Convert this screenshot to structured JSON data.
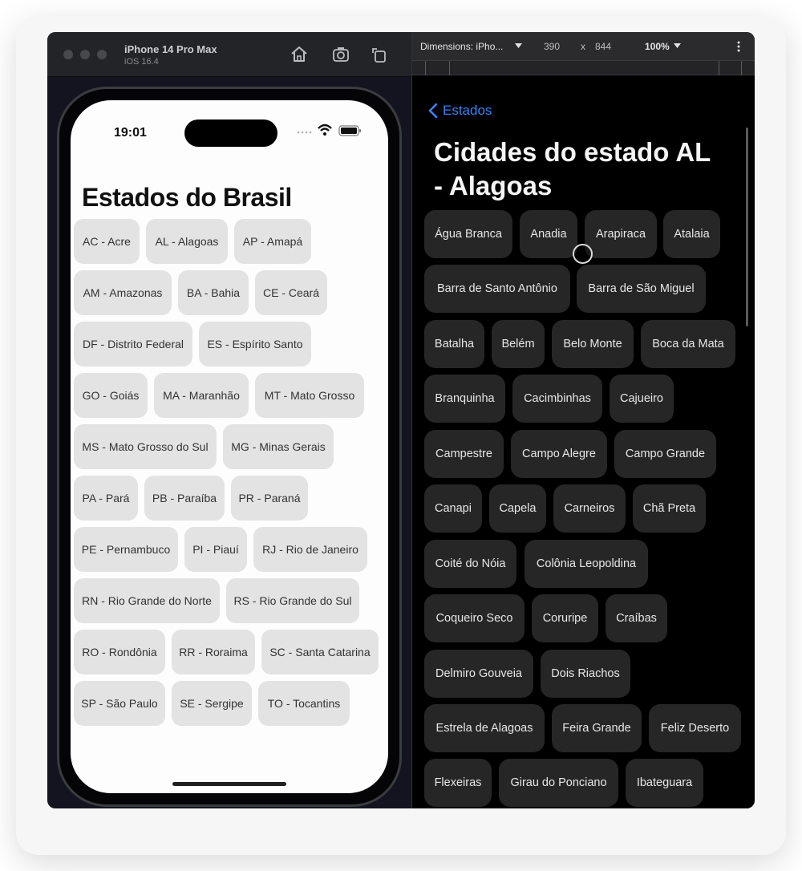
{
  "simulator": {
    "device_name": "iPhone 14 Pro Max",
    "os_version": "iOS 16.4",
    "toolbar_icons": [
      "home-icon",
      "screenshot-icon",
      "rotate-icon"
    ]
  },
  "phone": {
    "status_time": "19:01",
    "title": "Estados do Brasil",
    "states": [
      "AC - Acre",
      "AL - Alagoas",
      "AP - Amapá",
      "AM - Amazonas",
      "BA - Bahia",
      "CE - Ceará",
      "DF - Distrito Federal",
      "ES - Espírito Santo",
      "GO - Goiás",
      "MA - Maranhão",
      "MT - Mato Grosso",
      "MS - Mato Grosso do Sul",
      "MG - Minas Gerais",
      "PA - Pará",
      "PB - Paraíba",
      "PR - Paraná",
      "PE - Pernambuco",
      "PI - Piauí",
      "RJ - Rio de Janeiro",
      "RN - Rio Grande do Norte",
      "RS - Rio Grande do Sul",
      "RO - Rondônia",
      "RR - Roraima",
      "SC - Santa Catarina",
      "SP - São Paulo",
      "SE - Sergipe",
      "TO - Tocantins"
    ]
  },
  "devtools": {
    "dimensions_label": "Dimensions: iPho...",
    "width": "390",
    "times": "x",
    "height": "844",
    "zoom": "100%"
  },
  "browser": {
    "back_label": "Estados",
    "title": "Cidades do estado AL - Alagoas",
    "cities": [
      "Água Branca",
      "Anadia",
      "Arapiraca",
      "Atalaia",
      "Barra de Santo Antônio",
      "Barra de São Miguel",
      "Batalha",
      "Belém",
      "Belo Monte",
      "Boca da Mata",
      "Branquinha",
      "Cacimbinhas",
      "Cajueiro",
      "Campestre",
      "Campo Alegre",
      "Campo Grande",
      "Canapi",
      "Capela",
      "Carneiros",
      "Chã Preta",
      "Coité do Nóia",
      "Colônia Leopoldina",
      "Coqueiro Seco",
      "Coruripe",
      "Craíbas",
      "Delmiro Gouveia",
      "Dois Riachos",
      "Estrela de Alagoas",
      "Feira Grande",
      "Feliz Deserto",
      "Flexeiras",
      "Girau do Ponciano",
      "Ibateguara"
    ]
  },
  "colors": {
    "accent": "#3b82f6",
    "chip_light": "#e3e3e3",
    "chip_dark": "#262626"
  }
}
